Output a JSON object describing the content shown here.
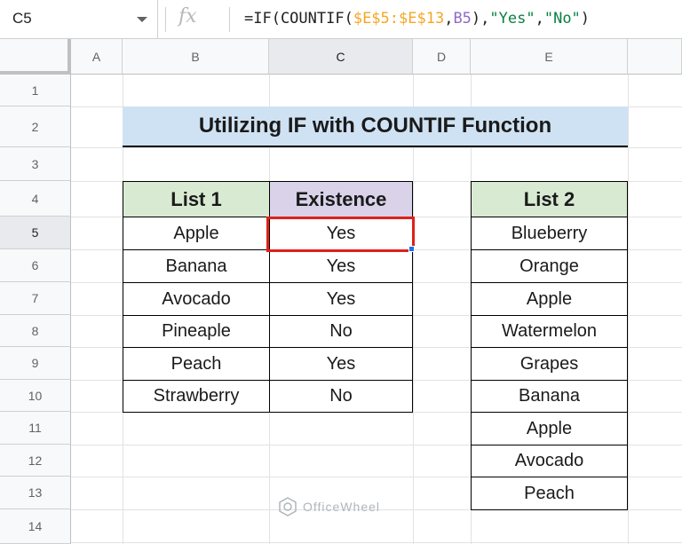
{
  "name_box": "C5",
  "formula": {
    "prefix": "=IF(COUNTIF(",
    "range": "$E$5:$E$13",
    "sep1": ",",
    "ref": "B5",
    "sep2": "),",
    "str_yes": "\"Yes\"",
    "sep3": ",",
    "str_no": "\"No\"",
    "suffix": ")"
  },
  "columns": [
    "A",
    "B",
    "C",
    "D",
    "E"
  ],
  "rows": [
    "1",
    "2",
    "3",
    "4",
    "5",
    "6",
    "7",
    "8",
    "9",
    "10",
    "11",
    "12",
    "13",
    "14"
  ],
  "title": "Utilizing IF with COUNTIF Function",
  "table1": {
    "headers": [
      "List 1",
      "Existence"
    ],
    "rows": [
      [
        "Apple",
        "Yes"
      ],
      [
        "Banana",
        "Yes"
      ],
      [
        "Avocado",
        "Yes"
      ],
      [
        "Pineaple",
        "No"
      ],
      [
        "Peach",
        "Yes"
      ],
      [
        "Strawberry",
        "No"
      ]
    ]
  },
  "table2": {
    "header": "List 2",
    "items": [
      "Blueberry",
      "Orange",
      "Apple",
      "Watermelon",
      "Grapes",
      "Banana",
      "Apple",
      "Avocado",
      "Peach"
    ]
  },
  "watermark": "OfficeWheel",
  "colors": {
    "title_bg": "#cfe2f3",
    "list_header_bg": "#d9ead3",
    "existence_header_bg": "#d9d2e9",
    "selection_border": "#e0201a"
  }
}
